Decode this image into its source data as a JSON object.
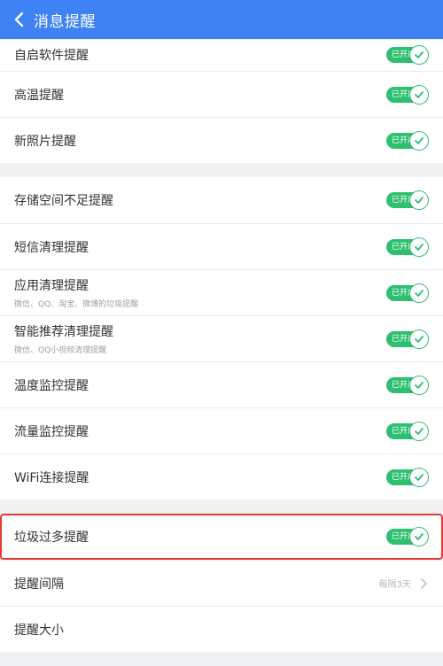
{
  "header": {
    "title": "消息提醒",
    "back_icon": "chevron-left-icon"
  },
  "toggle_label": "已开启",
  "colors": {
    "header_bg": "#3f82f3",
    "toggle_on": "#2fbf71",
    "highlight": "#e53935"
  },
  "groups": [
    {
      "items": [
        {
          "label": "自启软件提醒"
        },
        {
          "label": "高温提醒"
        },
        {
          "label": "新照片提醒"
        }
      ]
    },
    {
      "items": [
        {
          "label": "存储空间不足提醒"
        },
        {
          "label": "短信清理提醒"
        },
        {
          "label": "应用清理提醒",
          "sub": "微信、QQ、淘宝、微博的垃圾提醒"
        },
        {
          "label": "智能推荐清理提醒",
          "sub": "微信、QQ小视频清理提醒"
        },
        {
          "label": "温度监控提醒"
        },
        {
          "label": "流量监控提醒"
        },
        {
          "label": "WiFi连接提醒"
        }
      ]
    },
    {
      "items": [
        {
          "label": "垃圾过多提醒"
        },
        {
          "label": "提醒间隔",
          "value": "每隔3天"
        },
        {
          "label": "提醒大小"
        }
      ]
    }
  ]
}
